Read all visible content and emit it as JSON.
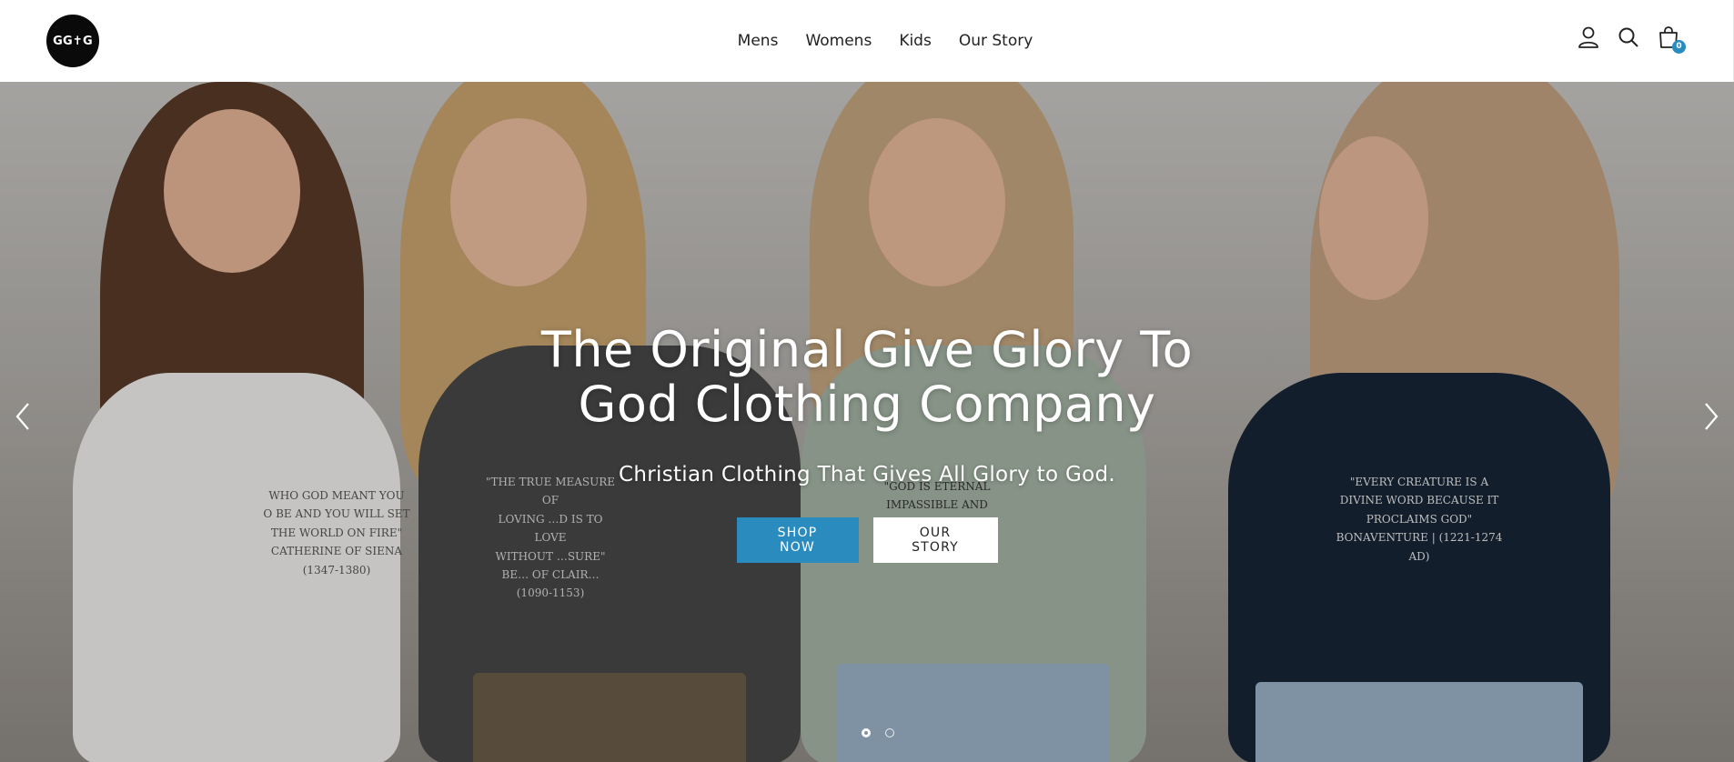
{
  "header": {
    "logo_text": "GG✝G",
    "nav": [
      {
        "label": "Mens"
      },
      {
        "label": "Womens"
      },
      {
        "label": "Kids"
      },
      {
        "label": "Our Story"
      }
    ],
    "icons": [
      "account-icon",
      "search-icon",
      "cart-icon"
    ],
    "cart_count": "0"
  },
  "hero": {
    "title": "The Original Give Glory To God Clothing Company",
    "subtitle": "Christian Clothing That Gives All Glory to God.",
    "primary_button": "SHOP NOW",
    "secondary_button": "OUR STORY",
    "slides_total": 2,
    "active_slide": 1,
    "shirt_1": "WHO GOD MEANT YOU\nO BE AND YOU WILL SET\nTHE WORLD ON FIRE\"\nCATHERINE OF SIENA\n(1347-1380)",
    "shirt_2": "\"THE TRUE MEASURE OF\nLOVING …D IS TO LOVE\nWITHOUT …SURE\"\nBE… OF CLAIR…\n(1090-1153)",
    "shirt_3": "\"GOD IS ETERNAL\nIMPASSIBLE AND\n\nARISTIDES | 123 AD",
    "shirt_4": "\"EVERY CREATURE IS A\nDIVINE WORD BECAUSE IT\nPROCLAIMS GOD\"\nBONAVENTURE | (1221-1274 AD)"
  },
  "colors": {
    "accent": "#2a8bbf",
    "logo_bg": "#0a0a0a",
    "text": "#222222"
  }
}
